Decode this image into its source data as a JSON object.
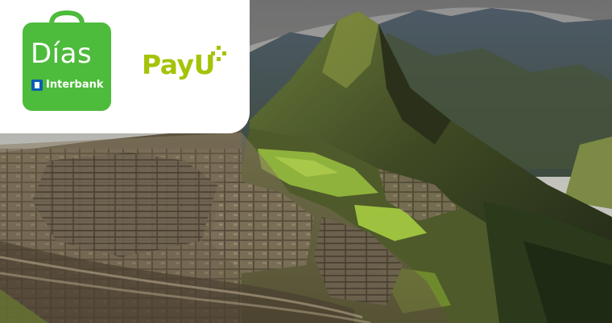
{
  "brands": {
    "dias_label": "Días",
    "interbank_label": "Interbank",
    "payu_label": "PayU",
    "dias_color": "#4dbb3b",
    "payu_color": "#a6c307",
    "interbank_blue": "#0e5bb5"
  },
  "photo": {
    "icon": "mountain-ruins-landscape"
  }
}
